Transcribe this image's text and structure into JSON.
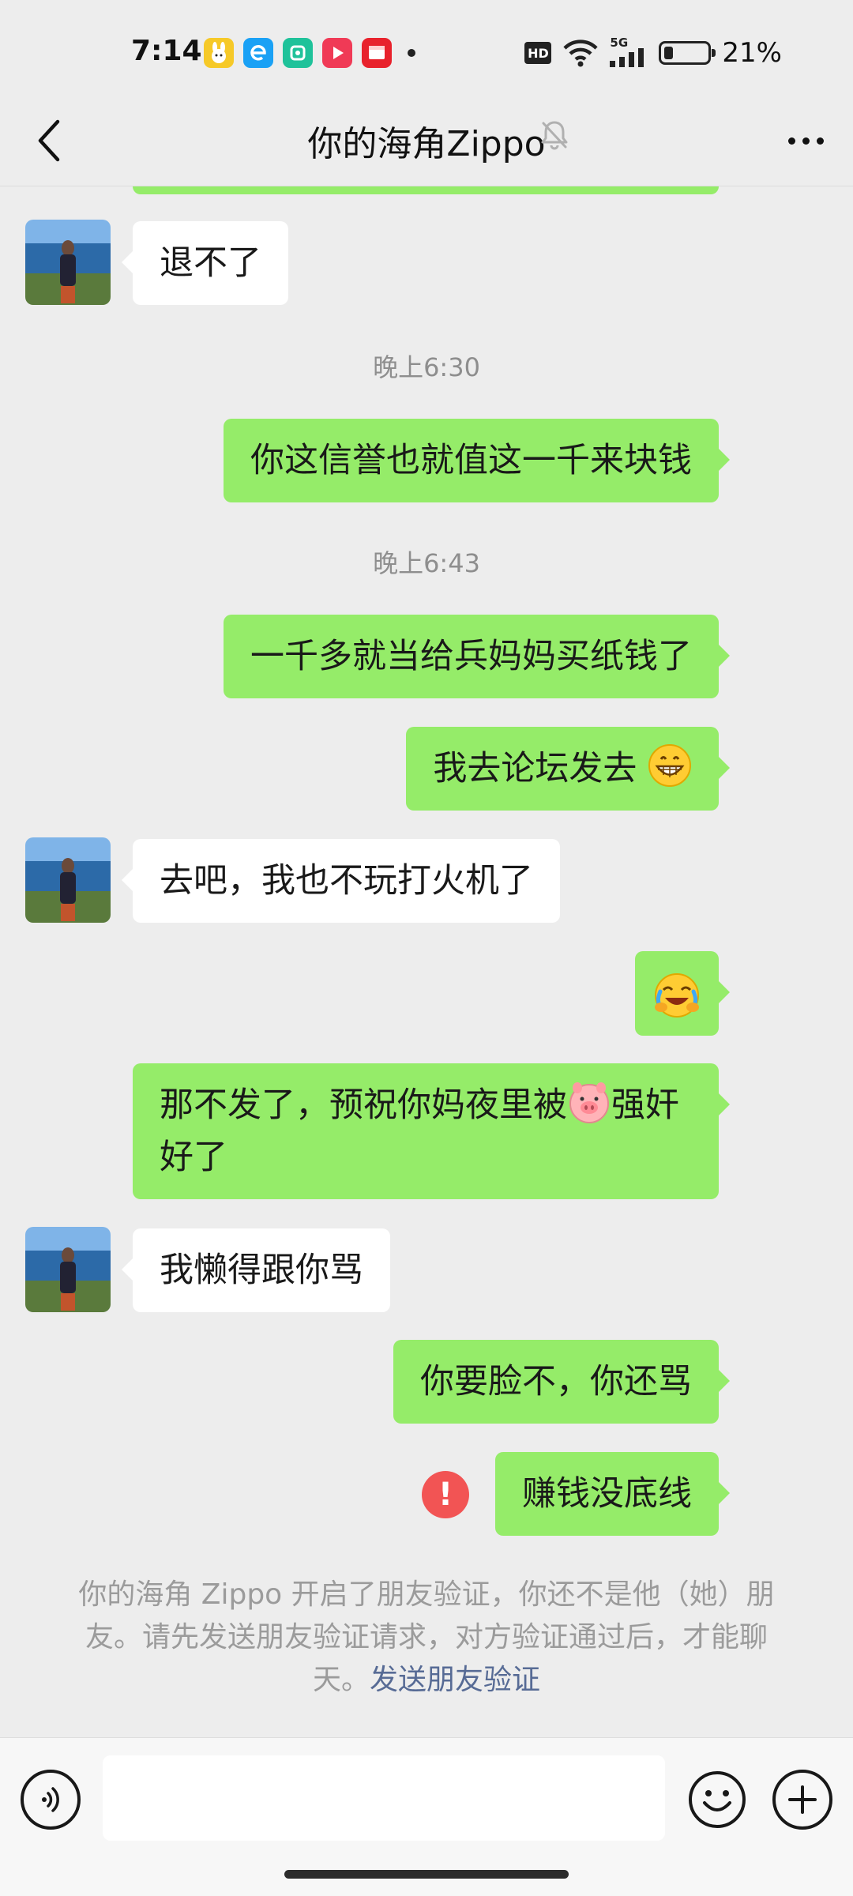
{
  "status_bar": {
    "time": "7:14",
    "battery_percent": "21%",
    "battery_level": 0.21,
    "network": "5G",
    "hd": "HD",
    "notification_icons": [
      "bunny-app-icon",
      "e-app-icon",
      "green-app-icon",
      "video-app-icon",
      "red-app-icon"
    ]
  },
  "header": {
    "title": "你的海角Zippo",
    "muted": true
  },
  "messages": [
    {
      "type": "text",
      "side": "in",
      "text": "退不了"
    },
    {
      "type": "time",
      "text": "晚上6:30"
    },
    {
      "type": "text",
      "side": "out",
      "text": "你这信誉也就值这一千来块钱"
    },
    {
      "type": "time",
      "text": "晚上6:43"
    },
    {
      "type": "text",
      "side": "out",
      "text": "一千多就当给兵妈妈买纸钱了"
    },
    {
      "type": "text",
      "side": "out",
      "text": "我去论坛发去",
      "emoji": "grinning-face-emoji"
    },
    {
      "type": "text",
      "side": "in",
      "text": "去吧，我也不玩打火机了"
    },
    {
      "type": "emoji",
      "side": "out",
      "emoji": "rolling-laughing-emoji"
    },
    {
      "type": "text",
      "side": "out",
      "text_before": "那不发了，预祝你妈夜里被",
      "emoji": "pig-face-emoji",
      "text_after": "强奸好了"
    },
    {
      "type": "text",
      "side": "in",
      "text": "我懒得跟你骂"
    },
    {
      "type": "text",
      "side": "out",
      "text": "你要脸不，你还骂"
    },
    {
      "type": "text",
      "side": "out",
      "text": "赚钱没底线",
      "failed": true
    }
  ],
  "error_mark": "!",
  "system_notice": {
    "text": "你的海角 Zippo 开启了朋友验证，你还不是他（她）朋友。请先发送朋友验证请求，对方验证通过后，才能聊天。",
    "link": "发送朋友验证"
  },
  "input_bar": {
    "placeholder": ""
  },
  "colors": {
    "background": "#ededed",
    "bubble_out": "#95ec69",
    "bubble_in": "#ffffff",
    "link": "#576b95",
    "error": "#f25454"
  }
}
